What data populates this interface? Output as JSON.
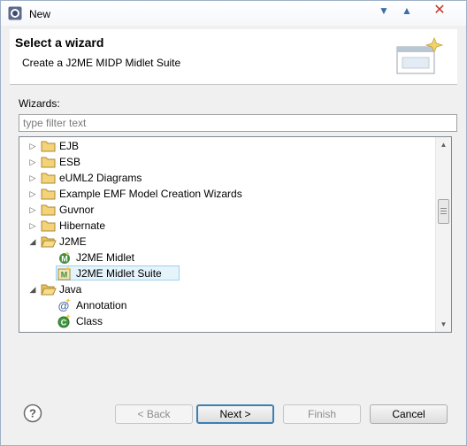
{
  "window": {
    "title": "New"
  },
  "header": {
    "title": "Select a wizard",
    "description": "Create a J2ME MIDP Midlet Suite"
  },
  "wizards": {
    "label": "Wizards:",
    "filter_placeholder": "type filter text",
    "filter_value": ""
  },
  "tree": {
    "items": [
      {
        "label": "EJB",
        "level": 0,
        "kind": "folder",
        "expanded": false
      },
      {
        "label": "ESB",
        "level": 0,
        "kind": "folder",
        "expanded": false
      },
      {
        "label": "eUML2 Diagrams",
        "level": 0,
        "kind": "folder",
        "expanded": false
      },
      {
        "label": "Example EMF Model Creation Wizards",
        "level": 0,
        "kind": "folder",
        "expanded": false
      },
      {
        "label": "Guvnor",
        "level": 0,
        "kind": "folder",
        "expanded": false
      },
      {
        "label": "Hibernate",
        "level": 0,
        "kind": "folder",
        "expanded": false
      },
      {
        "label": "J2ME",
        "level": 0,
        "kind": "folder",
        "expanded": true
      },
      {
        "label": "J2ME Midlet",
        "level": 1,
        "kind": "midlet-icon",
        "expanded": false
      },
      {
        "label": "J2ME Midlet Suite",
        "level": 1,
        "kind": "midlet-suite-icon",
        "expanded": false,
        "selected": true
      },
      {
        "label": "Java",
        "level": 0,
        "kind": "folder",
        "expanded": true
      },
      {
        "label": "Annotation",
        "level": 1,
        "kind": "annotation-icon",
        "expanded": false
      },
      {
        "label": "Class",
        "level": 1,
        "kind": "class-icon",
        "expanded": false
      }
    ]
  },
  "buttons": {
    "back": "< Back",
    "next": "Next >",
    "finish": "Finish",
    "cancel": "Cancel"
  },
  "colors": {
    "selection_fill": "#e5f3fb",
    "selection_border": "#9dd1f0",
    "folder": "#e8c35e",
    "default_button_border": "#3c7fb1"
  }
}
